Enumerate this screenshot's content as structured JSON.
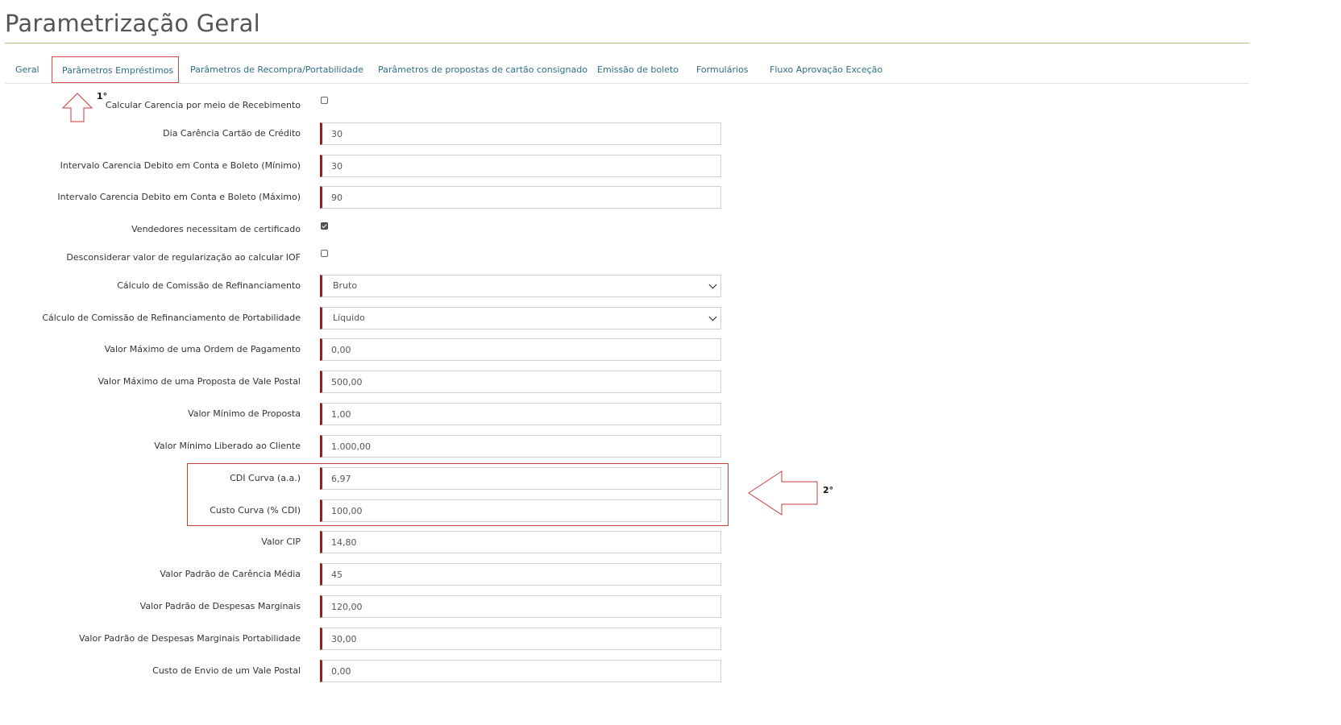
{
  "header": {
    "title": "Parametrização Geral"
  },
  "tabs": [
    {
      "label": "Geral"
    },
    {
      "label": "Parâmetros Empréstimos",
      "active": true
    },
    {
      "label": "Parâmetros de Recompra/Portabilidade"
    },
    {
      "label": "Parâmetros de propostas de cartão consignado"
    },
    {
      "label": "Emissão de boleto"
    },
    {
      "label": "Formulários"
    },
    {
      "label": "Fluxo Aprovação Exceção"
    }
  ],
  "annotations": {
    "step1": "1°",
    "step2": "2°"
  },
  "form": {
    "calcular_carencia": {
      "label": "Calcular Carencia por meio de Recebimento",
      "checked": false
    },
    "dia_carencia": {
      "label": "Dia Carência Cartão de Crédito",
      "value": "30"
    },
    "intervalo_min": {
      "label": "Intervalo Carencia Debito em Conta e Boleto (Mínimo)",
      "value": "30"
    },
    "intervalo_max": {
      "label": "Intervalo Carencia Debito em Conta e Boleto (Máximo)",
      "value": "90"
    },
    "vendedores_cert": {
      "label": "Vendedores necessitam de certificado",
      "checked": true
    },
    "desconsiderar_iof": {
      "label": "Desconsiderar valor de regularização ao calcular IOF",
      "checked": false
    },
    "comissao_refin": {
      "label": "Cálculo de Comissão de Refinanciamento",
      "value": "Bruto"
    },
    "comissao_refin_port": {
      "label": "Cálculo de Comissão de Refinanciamento de Portabilidade",
      "value": "Líquido"
    },
    "valor_max_ordem": {
      "label": "Valor Máximo de uma Ordem de Pagamento",
      "value": "0,00"
    },
    "valor_max_vale": {
      "label": "Valor Máximo de uma Proposta de Vale Postal",
      "value": "500,00"
    },
    "valor_min_proposta": {
      "label": "Valor Mínimo de Proposta",
      "value": "1,00"
    },
    "valor_min_liberado": {
      "label": "Valor Mínimo Liberado ao Cliente",
      "value": "1.000,00"
    },
    "cdi_curva": {
      "label": "CDI Curva (a.a.)",
      "value": "6,97"
    },
    "custo_curva": {
      "label": "Custo Curva (% CDI)",
      "value": "100,00"
    },
    "valor_cip": {
      "label": "Valor CIP",
      "value": "14,80"
    },
    "carencia_media": {
      "label": "Valor Padrão de Carência Média",
      "value": "45"
    },
    "despesas_marginais": {
      "label": "Valor Padrão de Despesas Marginais",
      "value": "120,00"
    },
    "despesas_marginais_port": {
      "label": "Valor Padrão de Despesas Marginais Portabilidade",
      "value": "30,00"
    },
    "custo_envio_vale": {
      "label": "Custo de Envio de um Vale Postal",
      "value": "0,00"
    }
  }
}
